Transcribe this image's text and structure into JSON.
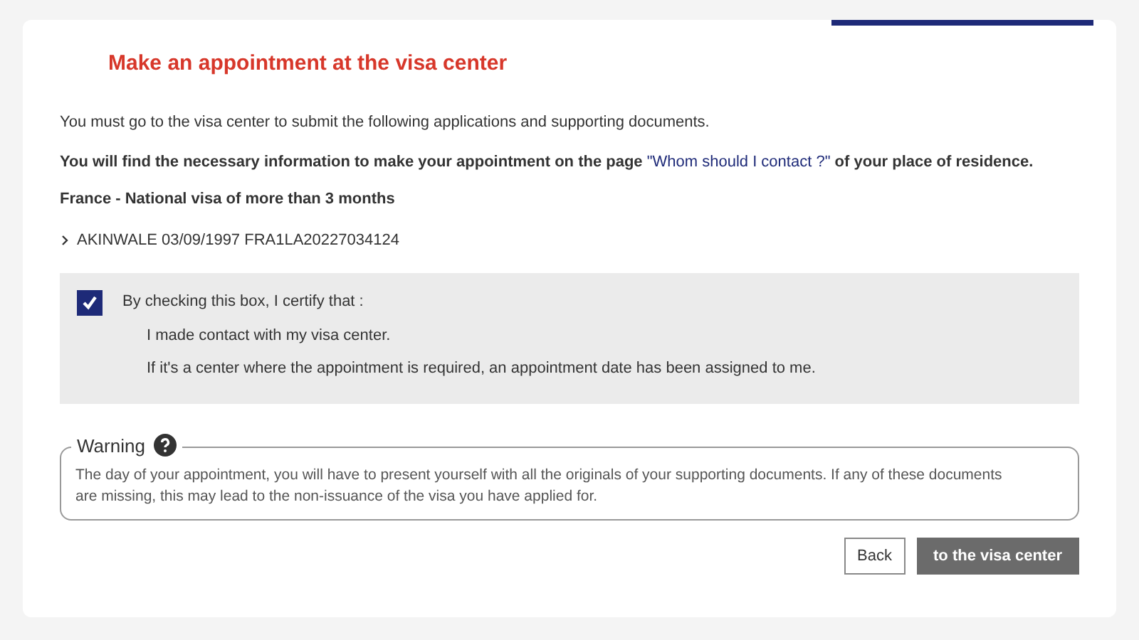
{
  "heading": "Make an appointment at the visa center",
  "intro": "You must go to the visa center to submit the following applications and supporting documents.",
  "info": {
    "before": "You will find the necessary information to make your appointment on the page ",
    "link": "\"Whom should I contact ?\"",
    "after": " of your place of residence."
  },
  "visa_type": "France - National visa of more than 3 months",
  "applicant": {
    "expanded": false,
    "label": "AKINWALE 03/09/1997 FRA1LA20227034124"
  },
  "certify": {
    "checked": true,
    "label": "By checking this box, I certify that :",
    "statements": [
      "I made contact with my visa center.",
      "If it's a center where the appointment is required, an appointment date has been assigned to me."
    ]
  },
  "warning": {
    "title": "Warning",
    "text": "The day of your appointment, you will have to present yourself with all the originals of your supporting documents. If any of these documents are missing, this may lead to the non-issuance of the visa you have applied for."
  },
  "buttons": [
    {
      "kind": "secondary",
      "label": "Back"
    },
    {
      "kind": "primary",
      "label": "to the visa center"
    }
  ]
}
